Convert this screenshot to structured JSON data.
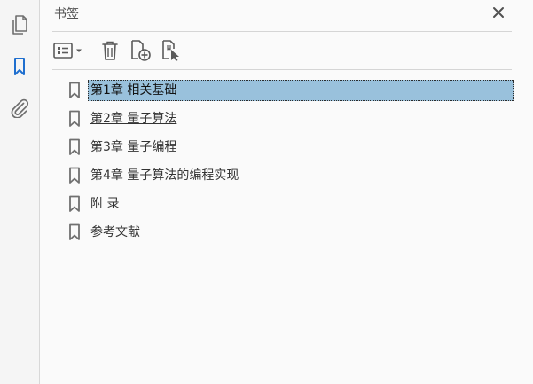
{
  "panel": {
    "title": "书签"
  },
  "colors": {
    "selection": "#99c1dc",
    "active_rail_icon": "#1f6fcf",
    "icon_gray": "#6e6e6e"
  },
  "icons": {
    "rail": [
      "pages-icon",
      "bookmark-icon",
      "paperclip-icon"
    ],
    "toolbar": [
      "options-menu-icon",
      "delete-icon",
      "new-bookmark-icon",
      "new-bookmark-from-selection-icon"
    ],
    "close": "close-icon"
  },
  "bookmarks": {
    "items": [
      {
        "label": "第1章 相关基础",
        "state": "selected"
      },
      {
        "label": "第2章 量子算法",
        "state": "hover"
      },
      {
        "label": "第3章 量子编程",
        "state": "normal"
      },
      {
        "label": "第4章 量子算法的编程实现",
        "state": "normal"
      },
      {
        "label": "附 录",
        "state": "normal"
      },
      {
        "label": "参考文献",
        "state": "normal"
      }
    ]
  }
}
